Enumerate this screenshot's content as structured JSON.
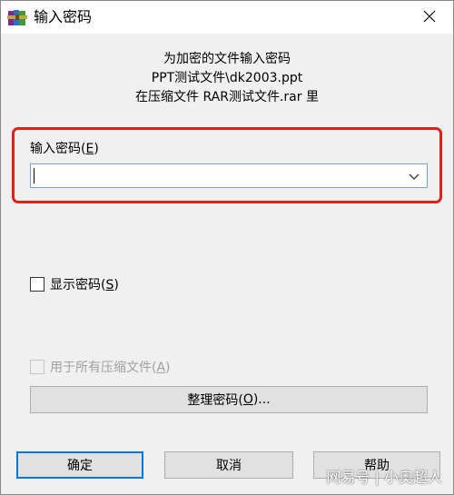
{
  "window": {
    "title": "输入密码"
  },
  "info": {
    "line1": "为加密的文件输入密码",
    "line2": "PPT测试文件\\dk2003.ppt",
    "line3": "在压缩文件 RAR测试文件.rar 里"
  },
  "password": {
    "label_prefix": "输入密码(",
    "label_key": "E",
    "label_suffix": ")",
    "value": ""
  },
  "show_password": {
    "label_prefix": "显示密码(",
    "label_key": "S",
    "label_suffix": ")",
    "checked": false
  },
  "apply_all": {
    "label_prefix": "用于所有压缩文件(",
    "label_key": "A",
    "label_suffix": ")",
    "checked": false,
    "disabled": true
  },
  "buttons": {
    "organize_prefix": "整理密码(",
    "organize_key": "O",
    "organize_suffix": ")...",
    "ok": "确定",
    "cancel": "取消",
    "help": "帮助"
  },
  "watermark": {
    "text": "网易号 | 小奥超人"
  },
  "colors": {
    "highlight_border": "#e0201b",
    "default_button_border": "#0078d7"
  },
  "icons": {
    "app": "winrar-books-icon",
    "close": "close-icon",
    "dropdown": "chevron-down-icon"
  }
}
